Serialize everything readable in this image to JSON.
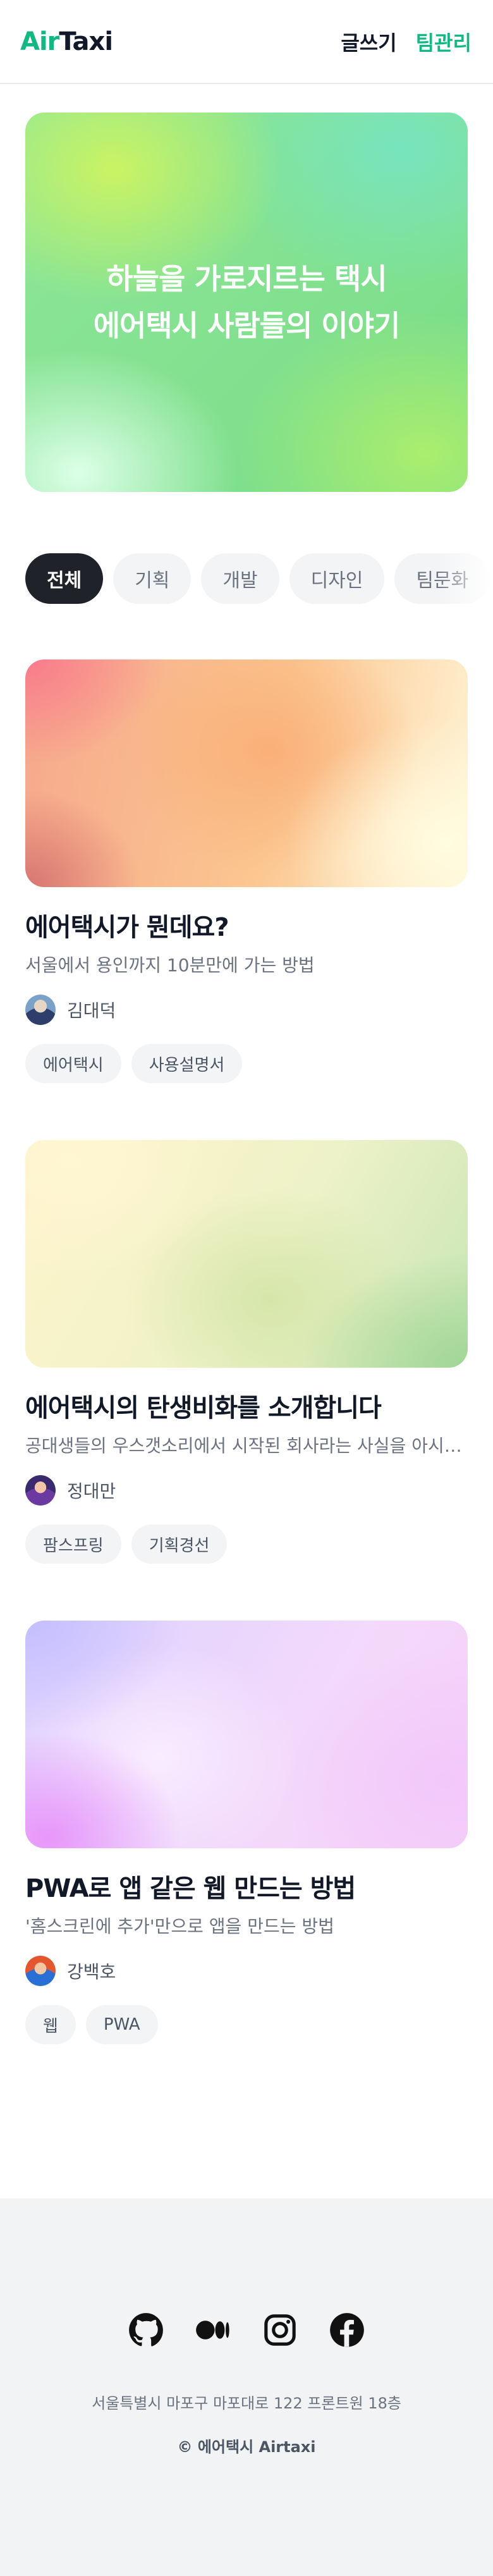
{
  "header": {
    "logo_air": "Air",
    "logo_taxi": "Taxi",
    "nav_write": "글쓰기",
    "nav_team_admin": "팀관리"
  },
  "hero": {
    "line1": "하늘을 가로지르는 택시",
    "line2": "에어택시 사람들의 이야기"
  },
  "categories": [
    {
      "label": "전체",
      "active": true
    },
    {
      "label": "기획",
      "active": false
    },
    {
      "label": "개발",
      "active": false
    },
    {
      "label": "디자인",
      "active": false
    },
    {
      "label": "팀문화",
      "active": false
    }
  ],
  "posts": [
    {
      "title": "에어택시가 뭔데요?",
      "description": "서울에서 용인까지 10분만에 가는 방법",
      "author": "김대덕",
      "tags": [
        "에어택시",
        "사용설명서"
      ]
    },
    {
      "title": "에어택시의 탄생비화를 소개합니다",
      "description": "공대생들의 우스갯소리에서 시작된 회사라는 사실을 아시나요?",
      "author": "정대만",
      "tags": [
        "팜스프링",
        "기획경선"
      ]
    },
    {
      "title": "PWA로 앱 같은 웹 만드는 방법",
      "description": "'홈스크린에 추가'만으로 앱을 만드는 방법",
      "author": "강백호",
      "tags": [
        "웹",
        "PWA"
      ]
    }
  ],
  "footer": {
    "social_icons": [
      "github-icon",
      "medium-icon",
      "instagram-icon",
      "facebook-icon"
    ],
    "address": "서울특별시 마포구 마포대로 122 프론트원 18층",
    "copyright": "© 에어택시 Airtaxi"
  },
  "colors": {
    "brand_green": "#10b981",
    "dark": "#1f2329",
    "footer_bg": "#f2f3f5"
  }
}
